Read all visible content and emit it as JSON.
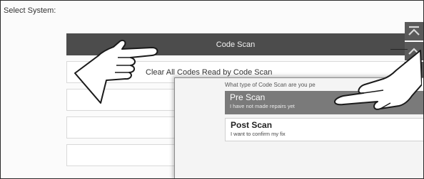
{
  "header": {
    "label": "Select System:"
  },
  "menu": {
    "items": [
      {
        "label": "Code Scan",
        "selected": true
      },
      {
        "label": "Clear All Codes Read by Code Scan",
        "selected": false
      },
      {
        "label": "",
        "selected": false
      },
      {
        "label": "",
        "selected": false
      },
      {
        "label": "",
        "selected": false
      }
    ]
  },
  "side_nav": {
    "buttons": [
      {
        "icon": "first-page-icon"
      },
      {
        "icon": "chevron-up-icon"
      },
      {
        "icon": "menu-icon"
      }
    ]
  },
  "popup": {
    "question": "What type of Code Scan are you pe",
    "options": [
      {
        "title": "Pre Scan",
        "subtitle": "I have not made repairs yet",
        "selected": true
      },
      {
        "title": "Post Scan",
        "subtitle": "I want to confirm my fix",
        "selected": false
      }
    ]
  },
  "colors": {
    "selected_row": "#4c4c4c",
    "selected_option": "#7a7a7a",
    "nav_button": "#5a5a5a"
  }
}
